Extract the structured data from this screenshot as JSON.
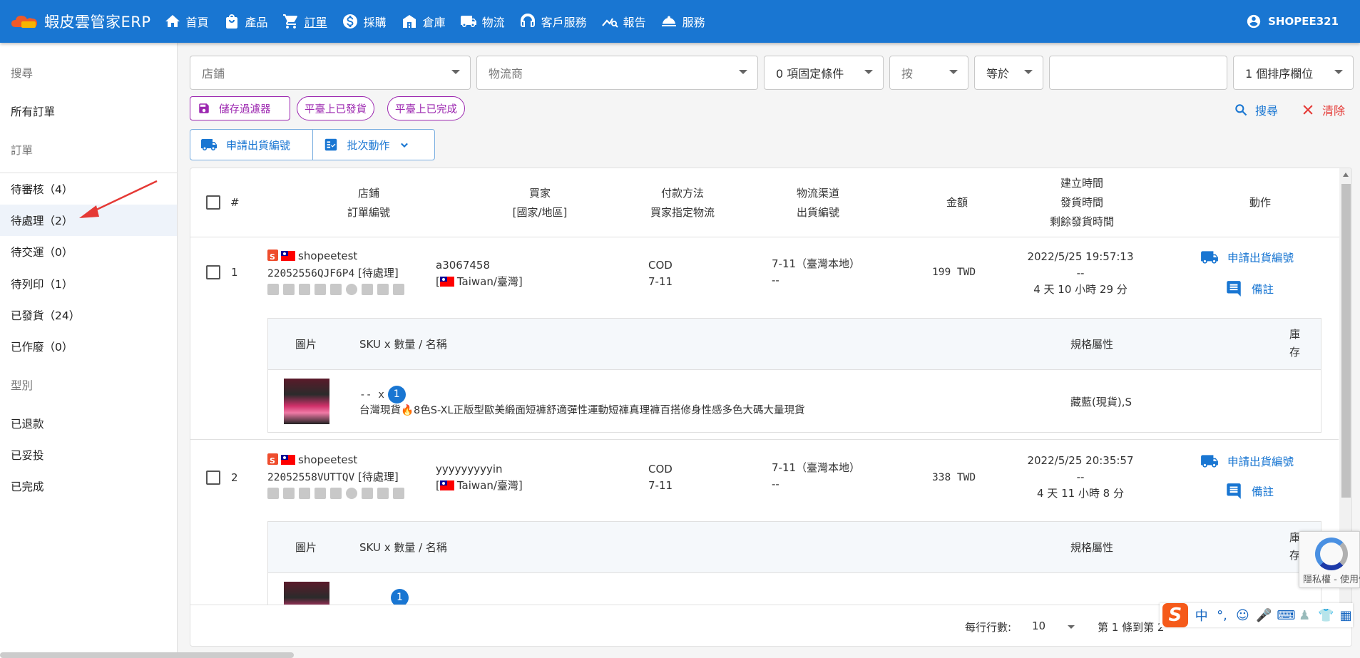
{
  "app": {
    "name": "蝦皮雲管家ERP",
    "logo_text": "Shopee321"
  },
  "nav": [
    {
      "label": "首頁",
      "icon": "home-icon"
    },
    {
      "label": "產品",
      "icon": "shopping-bag-icon"
    },
    {
      "label": "訂單",
      "icon": "cart-icon"
    },
    {
      "label": "採購",
      "icon": "dollar-icon"
    },
    {
      "label": "倉庫",
      "icon": "warehouse-icon"
    },
    {
      "label": "物流",
      "icon": "truck-icon"
    },
    {
      "label": "客戶服務",
      "icon": "support-icon"
    },
    {
      "label": "報告",
      "icon": "chart-icon"
    },
    {
      "label": "服務",
      "icon": "service-bell-icon"
    }
  ],
  "user": {
    "name": "SHOPEE321"
  },
  "sidebar": {
    "search": "搜尋",
    "all_orders": "所有訂單",
    "orders_header": "訂單",
    "items": [
      {
        "label": "待審核（4）"
      },
      {
        "label": "待處理（2）"
      },
      {
        "label": "待交運（0）"
      },
      {
        "label": "待列印（1）"
      },
      {
        "label": "已發貨（24）"
      },
      {
        "label": "已作廢（0）"
      }
    ],
    "type_header": "型別",
    "type_items": [
      {
        "label": "已退款"
      },
      {
        "label": "已妥投"
      },
      {
        "label": "已完成"
      }
    ]
  },
  "filters": {
    "shop_placeholder": "店鋪",
    "logistics_placeholder": "物流商",
    "conditions": "0 項固定條件",
    "by": "按",
    "equals": "等於",
    "value": "",
    "sort": "1 個排序欄位"
  },
  "chips": {
    "save_filter": "儲存過濾器",
    "shipped_on_platform": "平臺上已發貨",
    "completed_on_platform": "平臺上已完成"
  },
  "actions": {
    "search": "搜尋",
    "clear": "清除"
  },
  "toolbar": {
    "apply_shipping": "申請出貨編號",
    "batch_action": "批次動作"
  },
  "table": {
    "headers": {
      "no": "#",
      "shop": "店鋪",
      "order_no": "訂單編號",
      "buyer": "買家",
      "country": "[國家/地區]",
      "payment": "付款方法",
      "buyer_logistics": "買家指定物流",
      "channel": "物流渠道",
      "shipping_no": "出貨編號",
      "amount": "金額",
      "created": "建立時間",
      "shipped": "發貨時間",
      "remaining": "剩餘發貨時間",
      "action": "動作"
    },
    "sub_headers": {
      "image": "圖片",
      "sku": "SKU x 數量 / 名稱",
      "spec": "規格屬性",
      "stock": "庫存"
    },
    "rows": [
      {
        "index": "1",
        "shop": "shopeetest",
        "order_no": "22052556QJF6P4",
        "status": "[待處理]",
        "buyer": "a3067458",
        "country": "Taiwan/臺灣",
        "payment": "COD",
        "buyer_logistics": "7-11",
        "channel": "7-11（臺灣本地）",
        "shipping_no": "--",
        "amount": "199 TWD",
        "created": "2022/5/25 19:57:13",
        "shipped": "--",
        "remaining": "4 天 10 小時 29 分",
        "action_apply": "申請出貨編號",
        "action_note": "備註",
        "item": {
          "sku": "-- x",
          "qty": "1",
          "name": "台灣現貨🔥8色S-XL正版型歐美緞面短褲舒適彈性運動短褲真理褲百搭修身性感多色大碼大量現貨",
          "spec": "藏藍(現貨),S"
        }
      },
      {
        "index": "2",
        "shop": "shopeetest",
        "order_no": "22052558VUTTQV",
        "status": "[待處理]",
        "buyer": "yyyyyyyyyin",
        "country": "Taiwan/臺灣",
        "payment": "COD",
        "buyer_logistics": "7-11",
        "channel": "7-11（臺灣本地）",
        "shipping_no": "--",
        "amount": "338 TWD",
        "created": "2022/5/25 20:35:57",
        "shipped": "--",
        "remaining": "4 天 11 小時 8 分",
        "action_apply": "申請出貨編號",
        "action_note": "備註",
        "item": {
          "qty": "1"
        }
      }
    ]
  },
  "pager": {
    "rows_per_page_label": "每行行數:",
    "rows_per_page": "10",
    "range": "第 1 條到第 2"
  },
  "overlays": {
    "recaptcha_text": "隱私權 - 使用條款",
    "ime_label": "中"
  }
}
